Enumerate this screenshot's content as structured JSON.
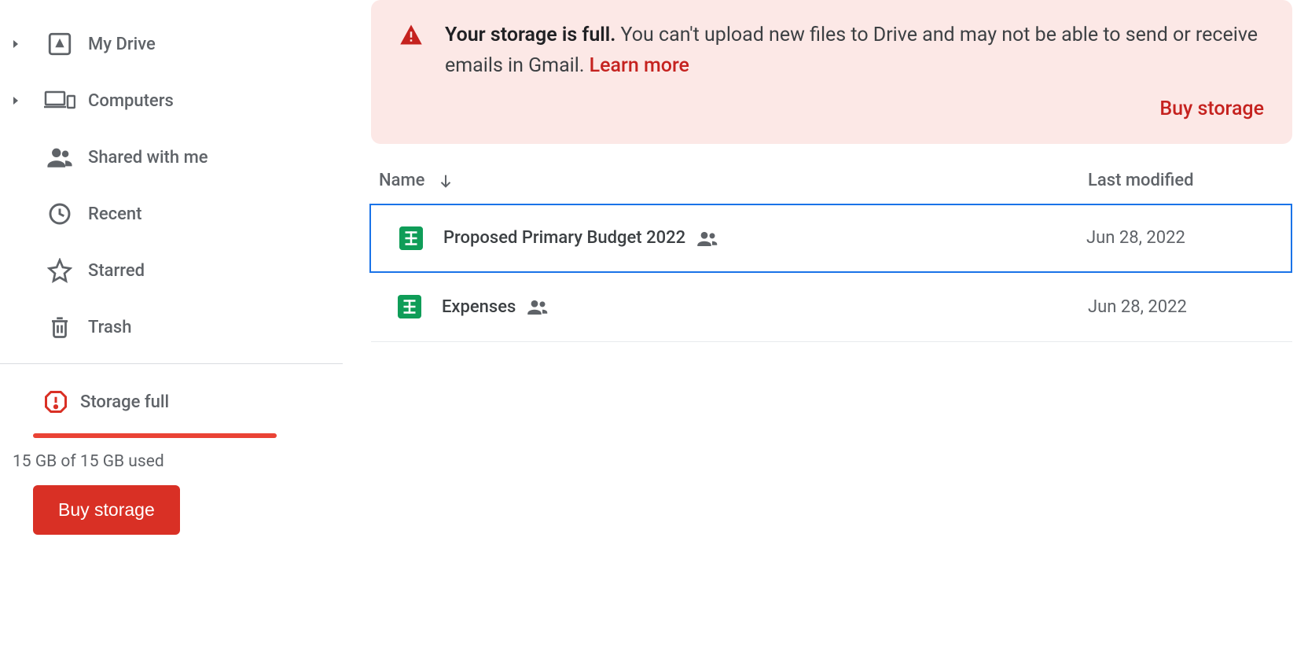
{
  "sidebar": {
    "items": [
      {
        "label": "My Drive",
        "expandable": true
      },
      {
        "label": "Computers",
        "expandable": true
      },
      {
        "label": "Shared with me",
        "expandable": false
      },
      {
        "label": "Recent",
        "expandable": false
      },
      {
        "label": "Starred",
        "expandable": false
      },
      {
        "label": "Trash",
        "expandable": false
      }
    ],
    "storage": {
      "status_label": "Storage full",
      "usage_text": "15 GB of 15 GB used",
      "buy_label": "Buy storage"
    }
  },
  "alert": {
    "strong": "Your storage is full.",
    "body": " You can't upload new files to Drive and may not be able to send or receive emails in Gmail. ",
    "learn_more": "Learn more",
    "action": "Buy storage"
  },
  "table": {
    "columns": {
      "name": "Name",
      "modified": "Last modified"
    }
  },
  "files": [
    {
      "name": "Proposed Primary Budget 2022",
      "modified": "Jun 28, 2022",
      "shared": true,
      "selected": true
    },
    {
      "name": "Expenses",
      "modified": "Jun 28, 2022",
      "shared": true,
      "selected": false
    }
  ]
}
